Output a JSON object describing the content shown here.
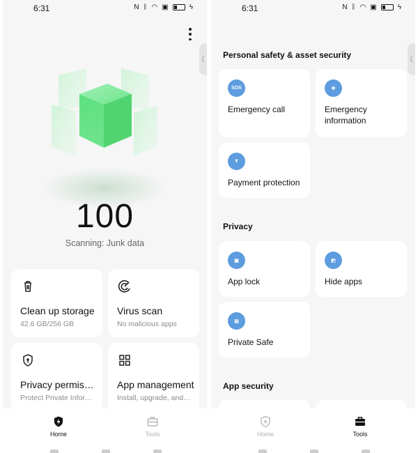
{
  "left": {
    "status": {
      "time": "6:31"
    },
    "score": "100",
    "scan_status": "Scanning: Junk data",
    "cards": [
      {
        "title": "Clean up storage",
        "subtitle": "42.6 GB/256 GB",
        "icon": "trash-icon"
      },
      {
        "title": "Virus scan",
        "subtitle": "No malicious apps",
        "icon": "radar-icon"
      },
      {
        "title": "Privacy permissions",
        "subtitle": "Protect Private Information",
        "icon": "shield-lock-icon"
      },
      {
        "title": "App management",
        "subtitle": "Install, upgrade, and uninstall",
        "icon": "grid-icon"
      }
    ],
    "nav": {
      "home": "Home",
      "tools": "Tools",
      "active": "Home"
    }
  },
  "right": {
    "status": {
      "time": "6:31"
    },
    "sections": {
      "safety": "Personal safety & asset security",
      "privacy": "Privacy",
      "app_security": "App security"
    },
    "tiles": {
      "emergency_call": "Emergency call",
      "emergency_info_line1": "Emergency",
      "emergency_info_line2": "information",
      "payment": "Payment protection",
      "app_lock": "App lock",
      "hide_apps": "Hide apps",
      "private_safe": "Private Safe",
      "sos_icon_text": "SOS"
    },
    "nav": {
      "home": "Home",
      "tools": "Tools",
      "active": "Tools"
    }
  },
  "colors": {
    "accent_blue": "#5d9cde",
    "cube_green": "#5fe07f",
    "background": "#f6f6f6"
  }
}
